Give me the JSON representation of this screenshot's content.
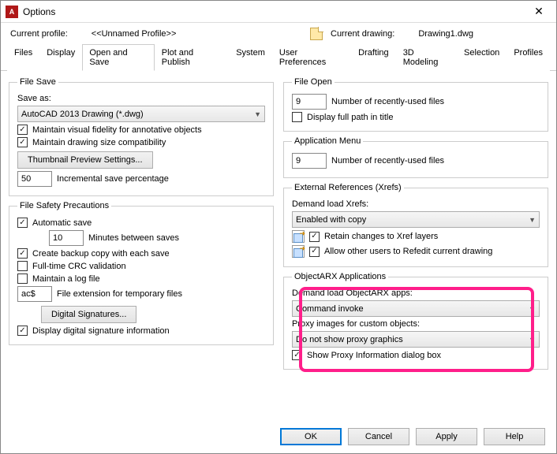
{
  "window": {
    "title": "Options"
  },
  "profile": {
    "label": "Current profile:",
    "value": "<<Unnamed Profile>>",
    "drawing_label": "Current drawing:",
    "drawing_value": "Drawing1.dwg"
  },
  "tabs": [
    "Files",
    "Display",
    "Open and Save",
    "Plot and Publish",
    "System",
    "User Preferences",
    "Drafting",
    "3D Modeling",
    "Selection",
    "Profiles"
  ],
  "file_save": {
    "legend": "File Save",
    "save_as_label": "Save as:",
    "save_as_value": "AutoCAD 2013 Drawing (*.dwg)",
    "maintain_visual": "Maintain visual fidelity for annotative objects",
    "maintain_size": "Maintain drawing size compatibility",
    "thumbnail_btn": "Thumbnail Preview Settings...",
    "incr_value": "50",
    "incr_label": "Incremental save percentage"
  },
  "file_safety": {
    "legend": "File Safety Precautions",
    "auto_save": "Automatic save",
    "minutes_value": "10",
    "minutes_label": "Minutes between saves",
    "backup": "Create backup copy with each save",
    "crc": "Full-time CRC validation",
    "logfile": "Maintain a log file",
    "ext_value": "ac$",
    "ext_label": "File extension for temporary files",
    "sig_btn": "Digital Signatures...",
    "display_sig": "Display digital signature information"
  },
  "file_open": {
    "legend": "File Open",
    "recent_value": "9",
    "recent_label": "Number of recently-used files",
    "full_path": "Display full path in title"
  },
  "app_menu": {
    "legend": "Application Menu",
    "recent_value": "9",
    "recent_label": "Number of recently-used files"
  },
  "xrefs": {
    "legend": "External References (Xrefs)",
    "demand_label": "Demand load Xrefs:",
    "demand_value": "Enabled with copy",
    "retain": "Retain changes to Xref layers",
    "allow_refedit": "Allow other users to Refedit current drawing"
  },
  "objectarx": {
    "legend": "ObjectARX Applications",
    "demand_label": "Demand load ObjectARX apps:",
    "demand_value": "Command invoke",
    "proxy_label": "Proxy images for custom objects:",
    "proxy_value": "Do not show proxy graphics",
    "show_proxy_info": "Show Proxy Information dialog box"
  },
  "footer": {
    "ok": "OK",
    "cancel": "Cancel",
    "apply": "Apply",
    "help": "Help"
  }
}
